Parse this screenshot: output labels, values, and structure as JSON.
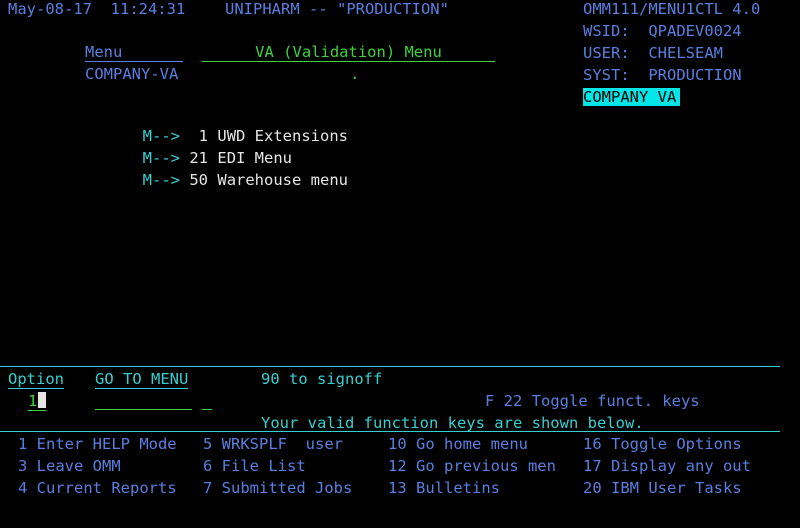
{
  "header": {
    "datetime": "May-08-17  11:24:31",
    "system_title": "UNIPHARM -- \"PRODUCTION\"",
    "program": "OMM111/MENU1CTL 4.0",
    "wsid": "WSID:  QPADEV0024",
    "user": "USER:  CHELSEAM",
    "syst": "SYST:  PRODUCTION",
    "company_badge": "COMPANY VA"
  },
  "menu": {
    "label": "Menu",
    "title": "VA (Validation) Menu",
    "code": "COMPANY-VA",
    "dot": ".",
    "items": [
      {
        "arrow": "M-->",
        "number": " 1",
        "label": "UWD Extensions"
      },
      {
        "arrow": "M-->",
        "number": "21",
        "label": "EDI Menu"
      },
      {
        "arrow": "M-->",
        "number": "50",
        "label": "Warehouse menu"
      }
    ]
  },
  "footer": {
    "option_label": "Option",
    "goto_label": "GO TO MENU",
    "signoff": "90 to signoff",
    "option_value": "1",
    "toggle_keys": "F 22 Toggle funct. keys",
    "valid_keys": "Your valid function keys are shown below.",
    "fkeys": [
      [
        "1 Enter HELP Mode",
        "5 WRKSPLF  user",
        "10 Go home menu",
        "16 Toggle Options"
      ],
      [
        "3 Leave OMM",
        "6 File List",
        "12 Go previous men",
        "17 Display any out"
      ],
      [
        "4 Current Reports",
        "7 Submitted Jobs",
        "13 Bulletins",
        "20 IBM User Tasks"
      ]
    ]
  },
  "colors": {
    "background": "#000000",
    "blue": "#5a7fe0",
    "green": "#3ed13e",
    "cyan": "#36d0d0",
    "white": "#e6e6e6",
    "highlight": "#00e5e5"
  }
}
